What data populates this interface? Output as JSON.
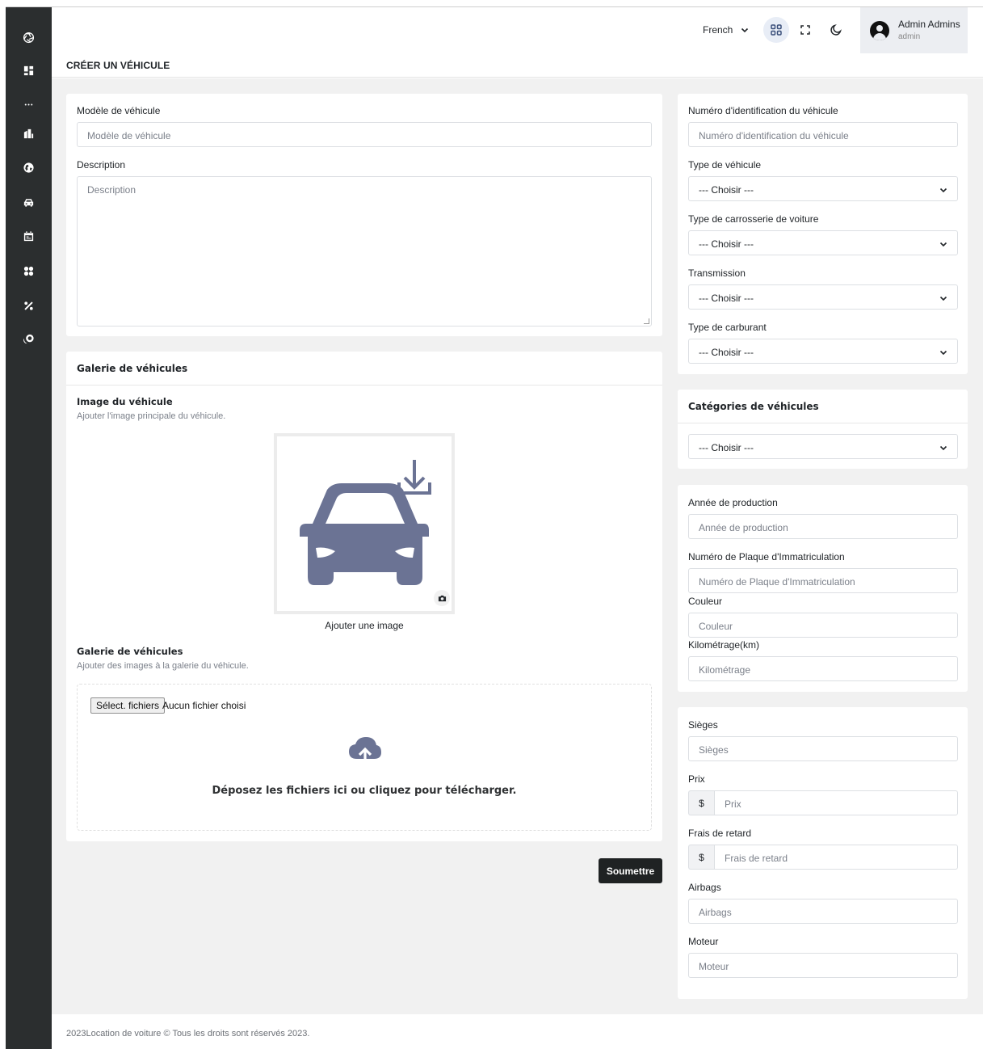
{
  "sidebar": {
    "icons": [
      "aperture-icon",
      "dashboard-icon",
      "more-icon",
      "building-icon",
      "globe-icon",
      "car-icon",
      "calendar-icon",
      "apps-icon",
      "percent-icon",
      "coins-icon"
    ]
  },
  "header": {
    "language": "French",
    "user_name": "Admin Admins",
    "user_role": "admin"
  },
  "page": {
    "title": "CRÉER UN VÉHICULE"
  },
  "main_form": {
    "model_label": "Modèle de véhicule",
    "model_placeholder": "Modèle de véhicule",
    "description_label": "Description",
    "description_placeholder": "Description"
  },
  "gallery": {
    "card_title": "Galerie de véhicules",
    "image_title": "Image du véhicule",
    "image_sub": "Ajouter l'image principale du véhicule.",
    "add_image": "Ajouter une image",
    "gallery_title": "Galerie de véhicules",
    "gallery_sub": "Ajouter des images à la galerie du véhicule.",
    "file_button": "Sélect. fichiers",
    "no_file": "Aucun fichier choisi",
    "drop_text": "Déposez les fichiers ici ou cliquez pour télécharger."
  },
  "submit_label": "Soumettre",
  "specs": {
    "vin_label": "Numéro d'identification du véhicule",
    "vin_placeholder": "Numéro d'identification du véhicule",
    "type_label": "Type de véhicule",
    "type_value": "--- Choisir ---",
    "body_label": "Type de carrosserie de voiture",
    "body_value": "--- Choisir ---",
    "transmission_label": "Transmission",
    "transmission_value": "--- Choisir ---",
    "fuel_label": "Type de carburant",
    "fuel_value": "--- Choisir ---"
  },
  "categories": {
    "title": "Catégories de véhicules",
    "value": "--- Choisir ---"
  },
  "details": {
    "year_label": "Année de production",
    "year_placeholder": "Année de production",
    "plate_label": "Numéro de Plaque d'Immatriculation",
    "plate_placeholder": "Numéro de Plaque d'Immatriculation",
    "color_label": "Couleur",
    "color_placeholder": "Couleur",
    "km_label": "Kilométrage(km)",
    "km_placeholder": "Kilométrage"
  },
  "extras": {
    "seats_label": "Sièges",
    "seats_placeholder": "Sièges",
    "price_label": "Prix",
    "price_prefix": "$",
    "price_placeholder": "Prix",
    "late_label": "Frais de retard",
    "late_prefix": "$",
    "late_placeholder": "Frais de retard",
    "airbags_label": "Airbags",
    "airbags_placeholder": "Airbags",
    "engine_label": "Moteur",
    "engine_placeholder": "Moteur"
  },
  "footer": {
    "text": "2023Location de voiture © Tous les droits sont réservés 2023."
  },
  "colors": {
    "sidebar": "#2b2e2f",
    "content_bg": "#f1f1f1",
    "car_illustration": "#6b7394",
    "submit_bg": "#1f2223"
  }
}
